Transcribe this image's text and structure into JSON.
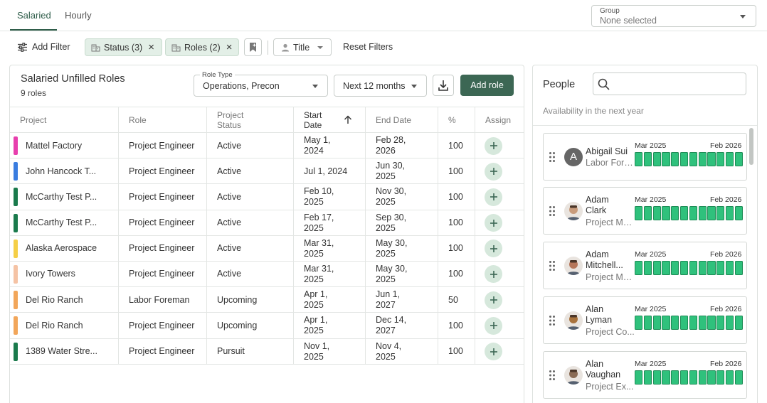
{
  "tabs": [
    {
      "label": "Salaried",
      "active": true
    },
    {
      "label": "Hourly",
      "active": false
    }
  ],
  "group": {
    "label": "Group",
    "value": "None selected"
  },
  "filters": {
    "add_filter": "Add Filter",
    "chips": [
      {
        "label": "Status (3)",
        "icon": "building-icon"
      },
      {
        "label": "Roles (2)",
        "icon": "building-icon"
      }
    ],
    "title_label": "Title",
    "reset": "Reset Filters"
  },
  "main": {
    "title": "Salaried Unfilled Roles",
    "count": "9 roles",
    "role_type": {
      "label": "Role Type",
      "value": "Operations, Precon"
    },
    "period": "Next 12 months",
    "add_role": "Add role",
    "columns": [
      {
        "key": "project",
        "label": "Project"
      },
      {
        "key": "role",
        "label": "Role"
      },
      {
        "key": "status",
        "label": "Project Status"
      },
      {
        "key": "start",
        "label": "Start Date",
        "sorted": "asc"
      },
      {
        "key": "end",
        "label": "End Date"
      },
      {
        "key": "pct",
        "label": "%"
      },
      {
        "key": "assign",
        "label": "Assign"
      }
    ],
    "rows": [
      {
        "color": "#e83fae",
        "project": "Mattel Factory",
        "role": "Project Engineer",
        "status": "Active",
        "start": "May 1, 2024",
        "end": "Feb 28, 2026",
        "pct": "100"
      },
      {
        "color": "#3a7de0",
        "project": "John Hancock T...",
        "role": "Project Engineer",
        "status": "Active",
        "start": "Jul 1, 2024",
        "end": "Jun 30, 2025",
        "pct": "100"
      },
      {
        "color": "#1a7a4c",
        "project": "McCarthy Test P...",
        "role": "Project Engineer",
        "status": "Active",
        "start": "Feb 10, 2025",
        "end": "Nov 30, 2025",
        "pct": "100"
      },
      {
        "color": "#1a7a4c",
        "project": "McCarthy Test P...",
        "role": "Project Engineer",
        "status": "Active",
        "start": "Feb 17, 2025",
        "end": "Sep 30, 2025",
        "pct": "100"
      },
      {
        "color": "#f5cf47",
        "project": "Alaska Aerospace",
        "role": "Project Engineer",
        "status": "Active",
        "start": "Mar 31, 2025",
        "end": "May 30, 2025",
        "pct": "100"
      },
      {
        "color": "#f5c3a5",
        "project": "Ivory Towers",
        "role": "Project Engineer",
        "status": "Active",
        "start": "Mar 31, 2025",
        "end": "May 30, 2025",
        "pct": "100"
      },
      {
        "color": "#f2a65a",
        "project": "Del Rio Ranch",
        "role": "Labor Foreman",
        "status": "Upcoming",
        "start": "Apr 1, 2025",
        "end": "Jun 1, 2027",
        "pct": "50"
      },
      {
        "color": "#f2a65a",
        "project": "Del Rio Ranch",
        "role": "Project Engineer",
        "status": "Upcoming",
        "start": "Apr 1, 2025",
        "end": "Dec 14, 2027",
        "pct": "100"
      },
      {
        "color": "#1a7a4c",
        "project": "1389 Water Stre...",
        "role": "Project Engineer",
        "status": "Pursuit",
        "start": "Nov 1, 2025",
        "end": "Nov 4, 2025",
        "pct": "100"
      }
    ]
  },
  "people": {
    "title": "People",
    "search_placeholder": "",
    "subtitle": "Availability in the next year",
    "range_start": "Mar 2025",
    "range_end": "Feb 2026",
    "list": [
      {
        "name_lines": [
          "Abigail Sui"
        ],
        "role": "Labor Fore...",
        "avatar": "A",
        "avatar_bg": "#666666",
        "months_available": 12
      },
      {
        "name_lines": [
          "Adam",
          "Clark"
        ],
        "role": "Project Ma...",
        "avatar_bg": "#c89b7b",
        "months_available": 12
      },
      {
        "name_lines": [
          "Adam",
          "Mitchell..."
        ],
        "role": "Project Ma...",
        "avatar_bg": "#b5765a",
        "months_available": 12
      },
      {
        "name_lines": [
          "Alan",
          "Lyman"
        ],
        "role": "Project Co...",
        "avatar_bg": "#a8723c",
        "months_available": 12
      },
      {
        "name_lines": [
          "Alan",
          "Vaughan"
        ],
        "role": "Project Ex...",
        "avatar_bg": "#8a6b55",
        "months_available": 12
      }
    ]
  }
}
